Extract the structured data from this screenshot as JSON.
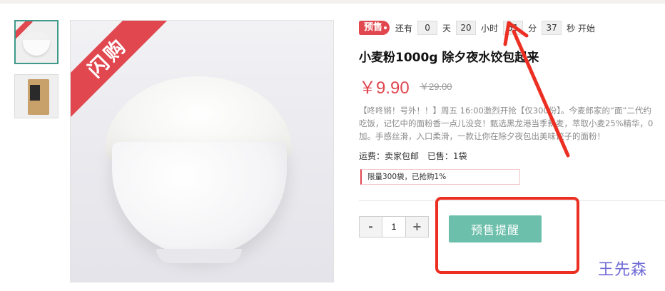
{
  "product": {
    "flash_sale_ribbon": "闪购",
    "title": "小麦粉1000g 除夕夜水饺包起来",
    "price": "￥9.90",
    "original_price": "￥29.00",
    "description_lines": [
      "【咚咚锵！号外！！】周五 16:00激烈开抢【仅300份】。今麦郎家的“面”二代约",
      "吃饭，记忆中的面粉香一点儿没变！甄选黑龙港当季新麦，萃取小麦25%精华，0",
      "加。手感丝滑，入口柔滑，一款让你在除夕夜包出美味饺子的面粉！"
    ],
    "shipping_label": "运费：卖家包邮",
    "sold_label": "已售：1袋",
    "limit_text": "限量300袋，已抢购1%"
  },
  "countdown": {
    "tag": "预售",
    "prefix": "还有",
    "days": "0",
    "days_unit": "天",
    "hours": "20",
    "hours_unit": "小时",
    "minutes": "51",
    "minutes_unit": "分",
    "seconds": "37",
    "seconds_unit": "秒 开始"
  },
  "purchase": {
    "decrement": "-",
    "quantity": "1",
    "increment": "+",
    "remind_button": "预售提醒"
  },
  "annotation": {
    "watermark": "王先森",
    "highlight_color": "#ec2f22"
  },
  "colors": {
    "brand_red": "#e0474f",
    "button_teal": "#6cbfab",
    "thumb_active_border": "#3f9a8a"
  }
}
